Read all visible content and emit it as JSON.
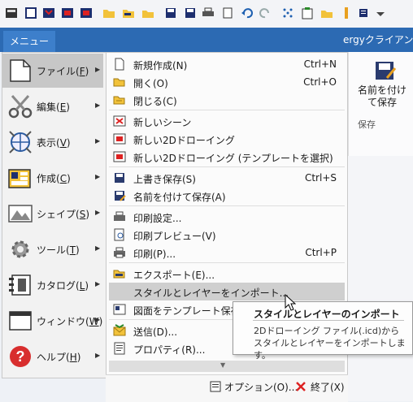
{
  "colors": {
    "menubar": "#2c6ab3",
    "menu_tab": "#3d7fcb",
    "highlight": "#cfcfcf"
  },
  "app": {
    "title_fragment": "ergyクライアント"
  },
  "menu_tab": {
    "label": "メニュー"
  },
  "toolbar": {
    "icons": [
      "app-icon",
      "new-doc-icon",
      "new-scene-icon",
      "new-2d-icon",
      "new-2d-template-icon",
      "open-folder-icon",
      "export-icon",
      "close-folder-icon",
      "save-icon",
      "save-as-icon",
      "print-icon",
      "print-preview-icon",
      "undo-icon",
      "redo-icon",
      "grid-icon",
      "clipboard-icon",
      "import-icon",
      "marker-icon",
      "list-dropdown-icon"
    ]
  },
  "ribbon": {
    "save_as_label": "名前を付けて保存",
    "group_label": "保存"
  },
  "left_menu": [
    {
      "label": "ファイル(",
      "key": "F",
      "tail": ")",
      "icon": "file-icon",
      "active": true
    },
    {
      "label": "編集(",
      "key": "E",
      "tail": ")",
      "icon": "scissors-icon",
      "active": false
    },
    {
      "label": "表示(",
      "key": "V",
      "tail": ")",
      "icon": "view-icon",
      "active": false
    },
    {
      "label": "作成(",
      "key": "C",
      "tail": ")",
      "icon": "create-icon",
      "active": false
    },
    {
      "label": "シェイプ(",
      "key": "S",
      "tail": ")",
      "icon": "shape-icon",
      "active": false
    },
    {
      "label": "ツール(",
      "key": "T",
      "tail": ")",
      "icon": "tool-icon",
      "active": false
    },
    {
      "label": "カタログ(",
      "key": "L",
      "tail": ")",
      "icon": "catalog-icon",
      "active": false
    },
    {
      "label": "ウィンドウ(",
      "key": "W",
      "tail": ")",
      "icon": "window-icon",
      "active": false
    },
    {
      "label": "ヘルプ(",
      "key": "H",
      "tail": ")",
      "icon": "help-icon",
      "active": false
    }
  ],
  "file_menu": [
    {
      "label": "新規作成(N)",
      "shortcut": "Ctrl+N",
      "icon": "new-doc-icon"
    },
    {
      "label": "開く(O)",
      "shortcut": "Ctrl+O",
      "icon": "open-folder-icon"
    },
    {
      "label": "閉じる(C)",
      "shortcut": "",
      "icon": "close-folder-icon"
    },
    {
      "label": "新しいシーン",
      "shortcut": "",
      "icon": "new-scene-icon"
    },
    {
      "label": "新しい2Dドローイング",
      "shortcut": "",
      "icon": "new-2d-icon"
    },
    {
      "label": "新しい2Dドローイング (テンプレートを選択)",
      "shortcut": "",
      "icon": "new-2d-template-icon"
    },
    {
      "label": "上書き保存(S)",
      "shortcut": "Ctrl+S",
      "icon": "save-icon"
    },
    {
      "label": "名前を付けて保存(A)",
      "shortcut": "",
      "icon": "save-as-icon"
    },
    {
      "label": "印刷設定...",
      "shortcut": "",
      "icon": "print-setup-icon"
    },
    {
      "label": "印刷プレビュー(V)",
      "shortcut": "",
      "icon": "print-preview-icon"
    },
    {
      "label": "印刷(P)...",
      "shortcut": "Ctrl+P",
      "icon": "print-icon"
    },
    {
      "label": "エクスポート(E)...",
      "shortcut": "",
      "icon": "export-icon"
    },
    {
      "label": "スタイルとレイヤーをインポート...",
      "shortcut": "",
      "icon": "",
      "highlighted": true
    },
    {
      "label": "図面をテンプレート保存",
      "shortcut": "",
      "icon": "template-save-icon"
    },
    {
      "label": "送信(D)...",
      "shortcut": "",
      "icon": "send-icon"
    },
    {
      "label": "プロパティ(R)...",
      "shortcut": "",
      "icon": "properties-icon"
    }
  ],
  "bottom": {
    "options_label": "オプション(O)...",
    "exit_label": "終了(X)"
  },
  "tooltip": {
    "title": "スタイルとレイヤーのインポート",
    "body": "2Dドローイング ファイル(.icd)からスタイルとレイヤーをインポートします。"
  }
}
